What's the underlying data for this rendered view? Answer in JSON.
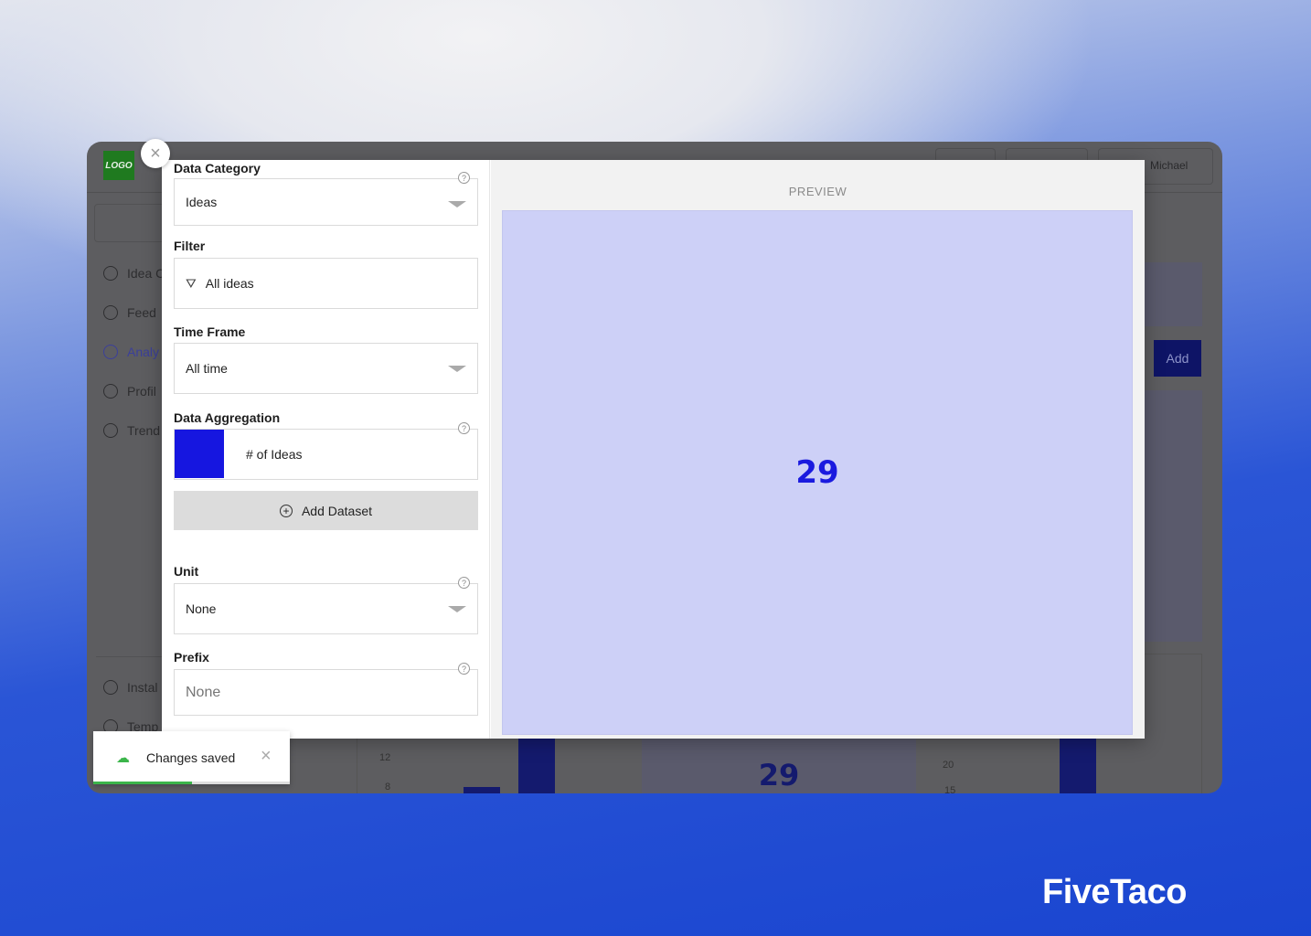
{
  "background_app": {
    "logo": "LOGO",
    "user_name": "Michael",
    "sidebar": [
      {
        "label": "Idea C",
        "icon": "flag-icon"
      },
      {
        "label": "Feed",
        "icon": "compass-icon"
      },
      {
        "label": "Analy",
        "icon": "pie-chart-icon",
        "active": true
      },
      {
        "label": "Profil",
        "icon": "profile-icon"
      },
      {
        "label": "Trend",
        "icon": "trend-icon"
      },
      {
        "label": "Instal",
        "icon": "install-icon"
      },
      {
        "label": "Temp",
        "icon": "template-icon"
      }
    ],
    "add_button": "Add",
    "axis_ticks_left": [
      "12",
      "8"
    ],
    "axis_ticks_right": [
      "20",
      "15"
    ],
    "card_number": "29"
  },
  "modal": {
    "form": {
      "data_category": {
        "label": "Data Category",
        "value": "Ideas"
      },
      "filter": {
        "label": "Filter",
        "value": "All ideas"
      },
      "time_frame": {
        "label": "Time Frame",
        "value": "All time"
      },
      "data_aggregation": {
        "label": "Data Aggregation",
        "value": "# of Ideas",
        "color": "#1616e0"
      },
      "add_dataset": "Add Dataset",
      "unit": {
        "label": "Unit",
        "value": "None"
      },
      "prefix": {
        "label": "Prefix",
        "placeholder": "None"
      }
    },
    "preview": {
      "title": "PREVIEW",
      "value": "29",
      "background": "#cdd0f7",
      "value_color": "#1a1adf"
    }
  },
  "toast": {
    "message": "Changes saved",
    "progress": 0.5
  },
  "brand": "FiveTaco"
}
